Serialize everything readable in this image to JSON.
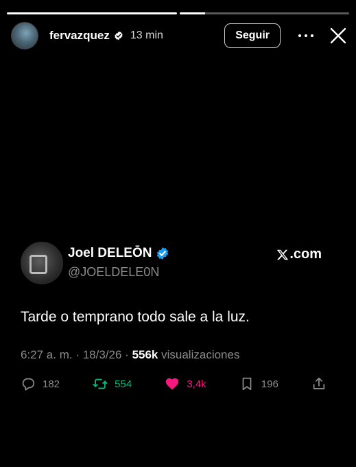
{
  "story": {
    "progress": [
      1.0,
      0.15
    ],
    "user": {
      "name": "fervazquez",
      "verified": true,
      "time": "13 min"
    },
    "follow_label": "Seguir",
    "icons": {
      "more": "more-dots-icon",
      "close": "close-icon"
    }
  },
  "tweet": {
    "author_name": "Joel DELEŌN",
    "handle": "@JOELDELE0N",
    "verified": true,
    "brand": ".com",
    "text": "Tarde o temprano todo sale a la luz.",
    "time": "6:27 a. m.",
    "date": "18/3/26",
    "views": "556k",
    "views_label": "visualizaciones",
    "replies": "182",
    "reposts": "554",
    "likes": "3,4k",
    "bookmarks": "196",
    "colors": {
      "verified": "#1d9bf0",
      "repost": "#00ba7c",
      "like": "#f91880",
      "muted": "#8b8b8b"
    }
  }
}
